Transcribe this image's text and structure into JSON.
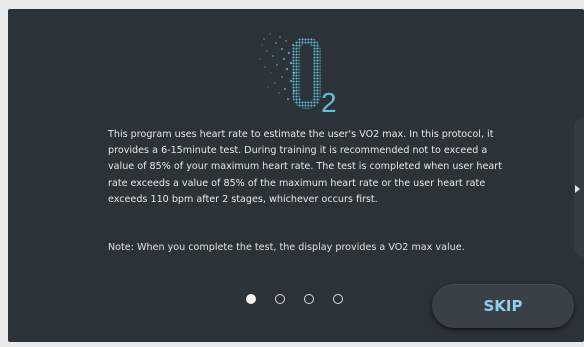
{
  "title": {
    "main": "O",
    "subscript": "2"
  },
  "description": "This program uses heart rate to estimate the user's VO2 max. In this protocol, it provides a 6-15minute test. During training it is recommended not to exceed a value of 85% of your maximum heart rate. The test is completed when user heart rate exceeds a value of 85% of the maximum heart rate or the user heart rate exceeds 110 bpm after 2 stages, whichever occurs first.",
  "note": "Note: When you complete the test, the display provides a VO2 max value.",
  "pagination": {
    "total": 4,
    "current": 1
  },
  "skip_label": "SKIP",
  "colors": {
    "background": "#2b3238",
    "accent": "#62c2d4",
    "text": "#e6e9ea",
    "button_text": "#8fd0ee"
  },
  "icons": {
    "next": "chevron-right-icon"
  }
}
